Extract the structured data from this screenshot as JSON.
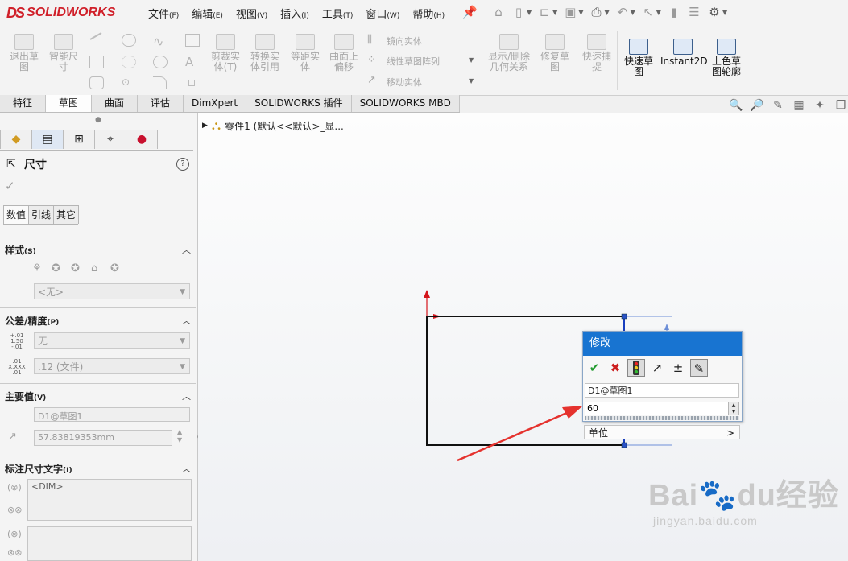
{
  "app": {
    "brand": "SOLIDWORKS",
    "brand_prefix": "DS"
  },
  "menu": [
    {
      "label": "文件",
      "key": "(F)"
    },
    {
      "label": "编辑",
      "key": "(E)"
    },
    {
      "label": "视图",
      "key": "(V)"
    },
    {
      "label": "插入",
      "key": "(I)"
    },
    {
      "label": "工具",
      "key": "(T)"
    },
    {
      "label": "窗口",
      "key": "(W)"
    },
    {
      "label": "帮助",
      "key": "(H)"
    }
  ],
  "ribbon": {
    "exit_sketch": "退出草\n图",
    "smart_dim": "智能尺\n寸",
    "trim": "剪裁实\n体(T)",
    "convert": "转换实\n体引用",
    "offset": "等距实\n体",
    "surface_offset": "曲面上\n偏移",
    "mirror": "镜向实体",
    "linear_pattern": "线性草图阵列",
    "move": "移动实体",
    "display_relations": "显示/删除\n几何关系",
    "repair": "修复草\n图",
    "quick_snap": "快速捕\n捉",
    "rapid_sketch": "快速草\n图",
    "instant2d": "Instant2D",
    "shaded_contours": "上色草\n图轮廓"
  },
  "tabs": [
    "特征",
    "草图",
    "曲面",
    "评估",
    "DimXpert",
    "SOLIDWORKS 插件",
    "SOLIDWORKS MBD"
  ],
  "active_tab": "草图",
  "property_manager": {
    "title": "尺寸",
    "help": "?",
    "subtabs": [
      "数值",
      "引线",
      "其它"
    ],
    "style": {
      "header": "样式",
      "key": "(S)",
      "dropdown": "<无>"
    },
    "tolerance": {
      "header": "公差/精度",
      "key": "(P)",
      "tol_icon_lines": [
        "+.01",
        "1.50",
        "-.01"
      ],
      "prec_icon_lines": [
        ".01",
        "X.XXX",
        ".01"
      ],
      "tol_value": "无",
      "precision_value": ".12 (文件)"
    },
    "primary": {
      "header": "主要值",
      "key": "(V)",
      "name": "D1@草图1",
      "value": "57.83819353mm"
    },
    "dim_text": {
      "header": "标注尺寸文字",
      "key": "(I)",
      "text": "<DIM>"
    }
  },
  "tree": {
    "root": "零件1  (默认<<默认>_显..."
  },
  "modify": {
    "title": "修改",
    "dim_name": "D1@草图1",
    "value": "60",
    "units_label": "单位",
    "units_arrow": ">"
  },
  "watermark": {
    "brand": "Bai",
    "du": "du",
    "cn": "经验",
    "url": "jingyan.baidu.com"
  }
}
